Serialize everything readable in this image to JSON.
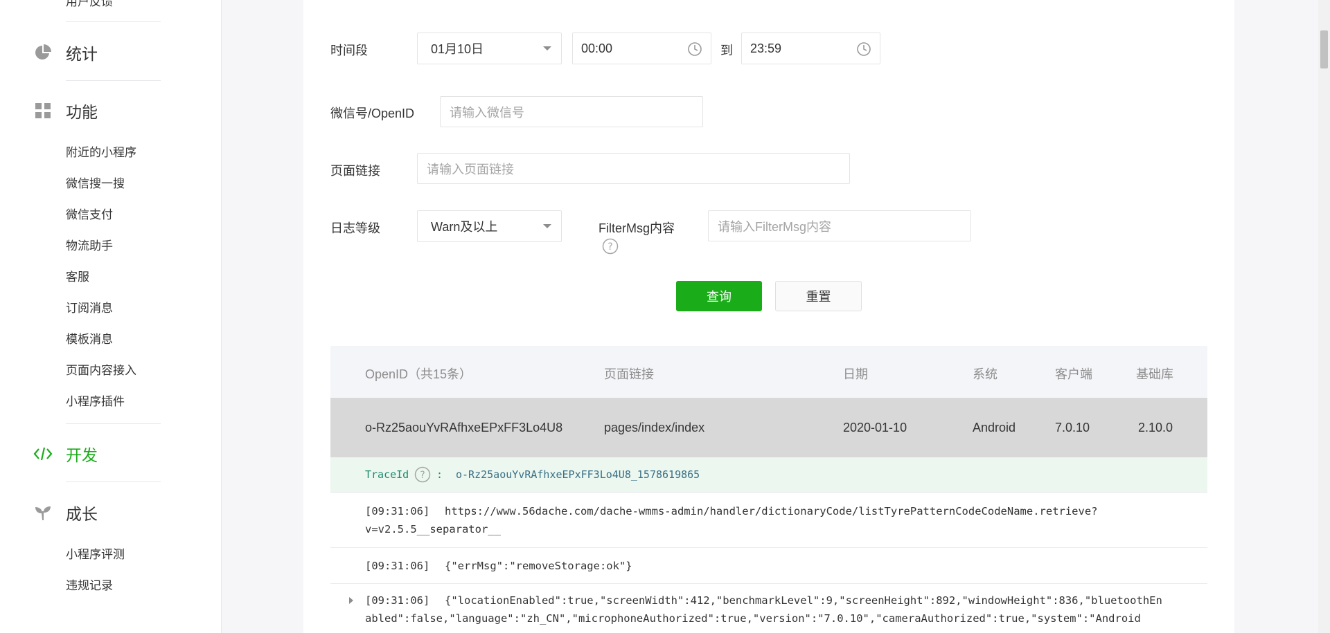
{
  "sidebar": {
    "top_item": "用户反馈",
    "sections": [
      {
        "label": "统计",
        "icon": "pie-chart-icon"
      },
      {
        "label": "功能",
        "icon": "grid-icon"
      },
      {
        "label": "开发",
        "icon": "code-icon"
      },
      {
        "label": "成长",
        "icon": "sprout-icon"
      }
    ],
    "function_items": [
      "附近的小程序",
      "微信搜一搜",
      "微信支付",
      "物流助手",
      "客服",
      "订阅消息",
      "模板消息",
      "页面内容接入",
      "小程序插件"
    ],
    "growth_items": [
      "小程序评测",
      "违规记录"
    ]
  },
  "filters": {
    "time_label": "时间段",
    "date_value": "01月10日",
    "start_time": "00:00",
    "to_label": "到",
    "end_time": "23:59",
    "wechat_label": "微信号/OpenID",
    "wechat_placeholder": "请输入微信号",
    "page_label": "页面链接",
    "page_placeholder": "请输入页面链接",
    "level_label": "日志等级",
    "level_value": "Warn及以上",
    "filtermsg_label": "FilterMsg内容",
    "filtermsg_placeholder": "请输入FilterMsg内容",
    "query_button": "查询",
    "reset_button": "重置"
  },
  "table": {
    "headers": {
      "openid": "OpenID（共15条）",
      "page": "页面链接",
      "date": "日期",
      "system": "系统",
      "client": "客户端",
      "lib": "基础库"
    },
    "row": {
      "openid": "o-Rz25aouYvRAfhxeEPxFF3Lo4U8",
      "page": "pages/index/index",
      "date": "2020-01-10",
      "system": "Android",
      "client": "7.0.10",
      "lib": "2.10.0"
    },
    "trace": {
      "key": "TraceId",
      "separator": ":",
      "value": "o-Rz25aouYvRAfhxeEPxFF3Lo4U8_1578619865"
    },
    "logs": [
      {
        "time": "[09:31:06]",
        "lines": [
          "https://www.56dache.com/dache-wmms-admin/handler/dictionaryCode/listTyrePatternCodeCodeName.retrieve?",
          "v=v2.5.5__separator__"
        ]
      },
      {
        "time": "[09:31:06]",
        "lines": [
          "{\"errMsg\":\"removeStorage:ok\"}"
        ]
      },
      {
        "time": "[09:31:06]",
        "lines": [
          "{\"locationEnabled\":true,\"screenWidth\":412,\"benchmarkLevel\":9,\"screenHeight\":892,\"windowHeight\":836,\"bluetoothEn",
          "abled\":false,\"language\":\"zh_CN\",\"microphoneAuthorized\":true,\"version\":\"7.0.10\",\"cameraAuthorized\":true,\"system\":\"Android"
        ]
      }
    ]
  }
}
